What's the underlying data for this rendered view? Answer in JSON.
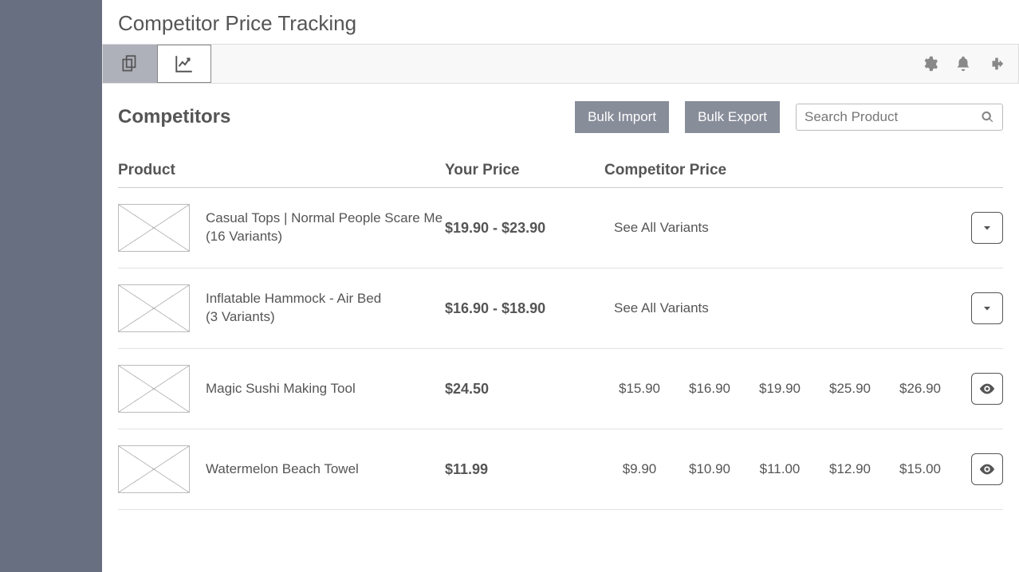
{
  "page_title": "Competitor Price Tracking",
  "subheader_title": "Competitors",
  "buttons": {
    "bulk_import": "Bulk Import",
    "bulk_export": "Bulk Export"
  },
  "search": {
    "placeholder": "Search Product",
    "value": ""
  },
  "table": {
    "headers": {
      "product": "Product",
      "your_price": "Your Price",
      "competitor_price": "Competitor Price"
    },
    "rows": [
      {
        "name": "Casual Tops | Normal People Scare Me",
        "variants_label": "(16 Variants)",
        "your_price": "$19.90 - $23.90",
        "competitor_display": "variants",
        "competitor_text": "See All Variants",
        "action": "expand"
      },
      {
        "name": "Inflatable Hammock - Air Bed",
        "variants_label": "(3 Variants)",
        "your_price": "$16.90 - $18.90",
        "competitor_display": "variants",
        "competitor_text": "See All Variants",
        "action": "expand"
      },
      {
        "name": "Magic Sushi Making Tool",
        "variants_label": "",
        "your_price": "$24.50",
        "competitor_display": "prices",
        "competitor_prices": [
          "$15.90",
          "$16.90",
          "$19.90",
          "$25.90",
          "$26.90"
        ],
        "action": "view"
      },
      {
        "name": "Watermelon Beach Towel",
        "variants_label": "",
        "your_price": "$11.99",
        "competitor_display": "prices",
        "competitor_prices": [
          "$9.90",
          "$10.90",
          "$11.00",
          "$12.90",
          "$15.00"
        ],
        "action": "view"
      }
    ]
  }
}
